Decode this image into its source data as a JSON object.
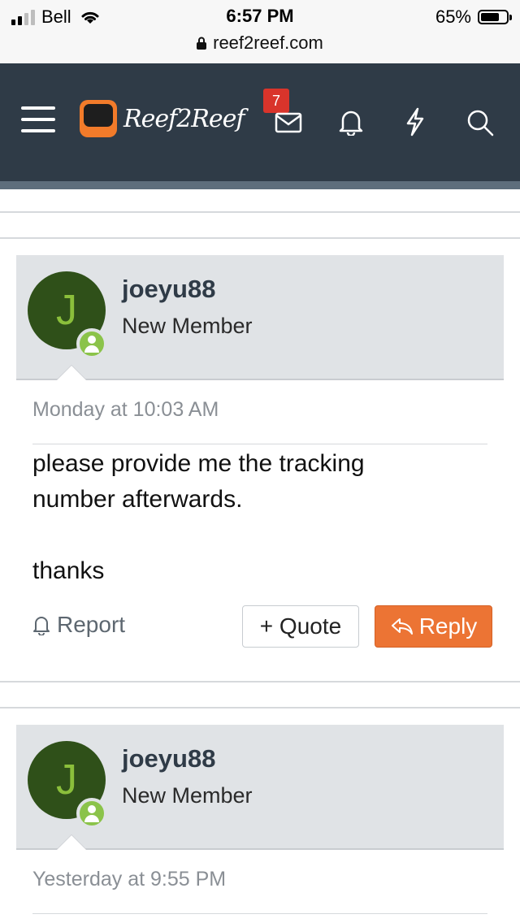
{
  "status_bar": {
    "carrier": "Bell",
    "time": "6:57 PM",
    "battery": "65%",
    "battery_level": 0.65,
    "url": "reef2reef.com"
  },
  "nav": {
    "logo_text": "Reef2Reef",
    "inbox_badge": "7",
    "icons": [
      "menu-icon",
      "mail-icon",
      "bell-icon",
      "lightning-icon",
      "search-icon"
    ]
  },
  "posts": [
    {
      "username": "joeyu88",
      "user_title": "New Member",
      "avatar_letter": "J",
      "date": "Monday at 10:03 AM",
      "body_line1": "please provide me the tracking",
      "body_line2": "number afterwards.",
      "body_line3": "thanks",
      "report_label": "Report",
      "quote_label": "+ Quote",
      "reply_label": "Reply"
    },
    {
      "username": "joeyu88",
      "user_title": "New Member",
      "avatar_letter": "J",
      "date": "Yesterday at 9:55 PM"
    }
  ],
  "colors": {
    "nav_bg": "#2f3b47",
    "avatar_bg": "#2f5019",
    "avatar_letter": "#8bbf3b",
    "online": "#8bc34a",
    "badge": "#d9342b",
    "reply_button": "#ec7434"
  }
}
